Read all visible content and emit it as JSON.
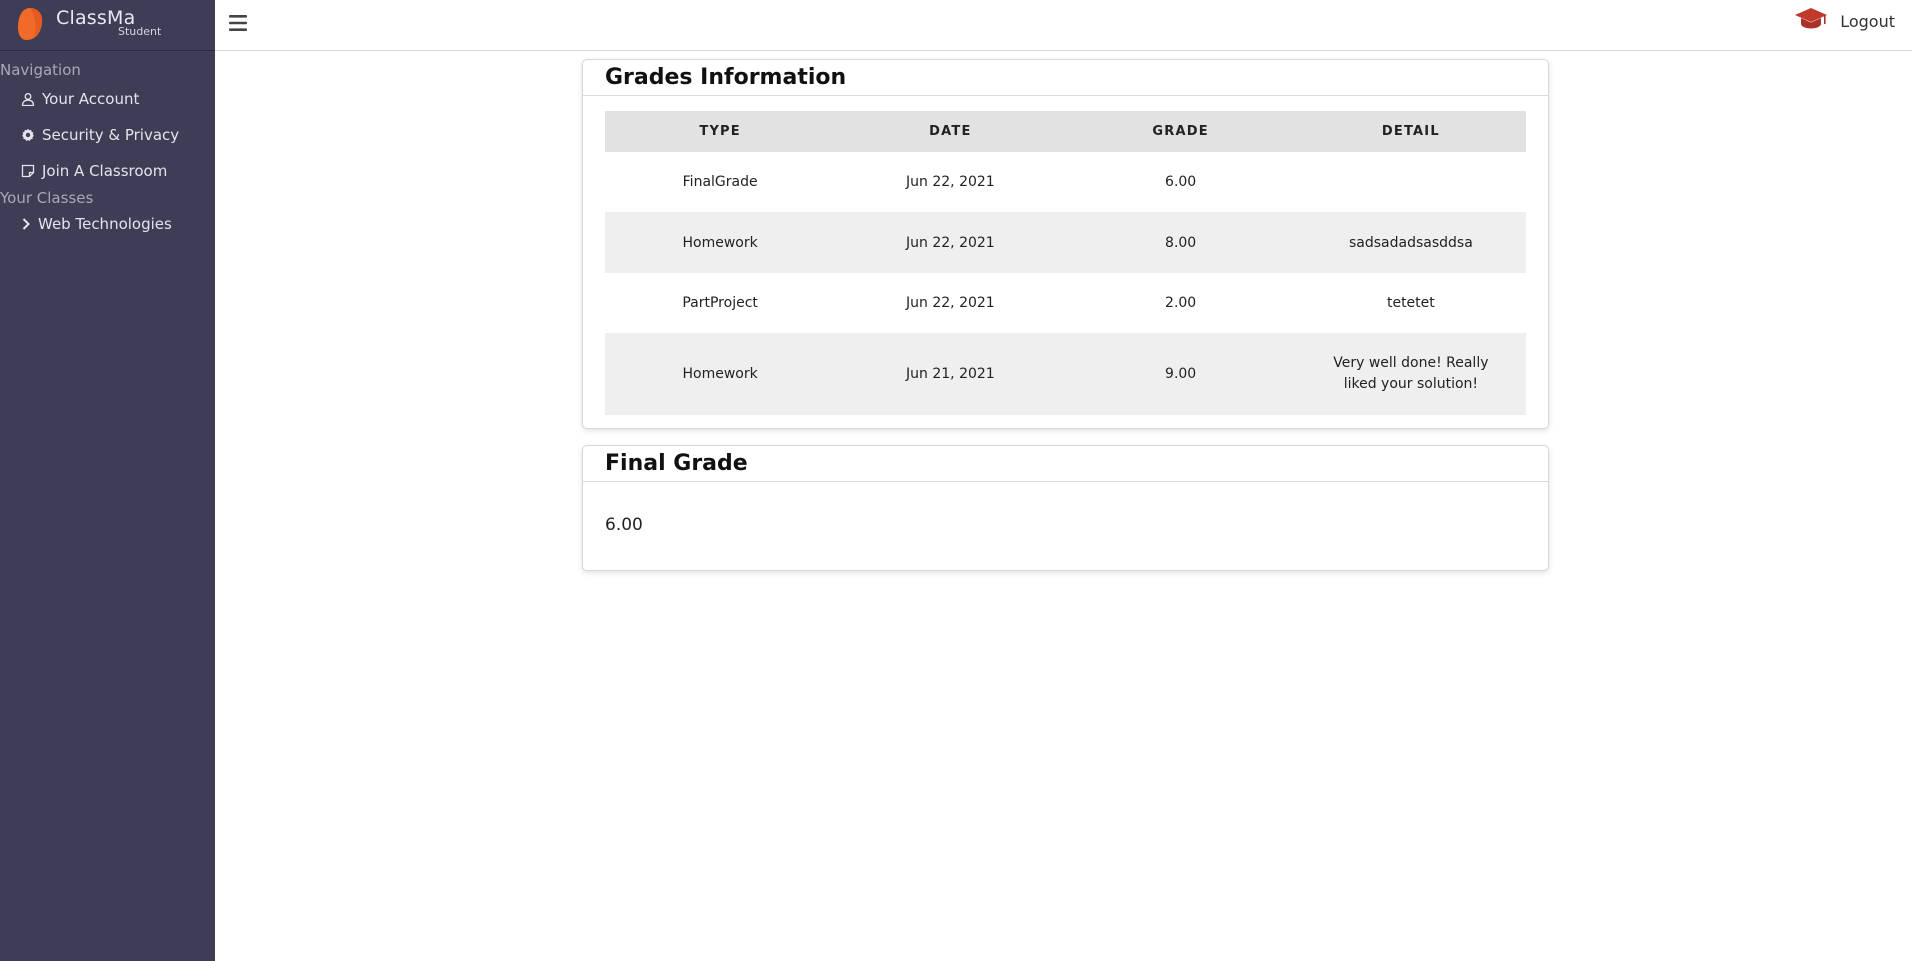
{
  "brand": {
    "name": "ClassMa",
    "role": "Student",
    "logo_color": "#f26a2a"
  },
  "sidebar": {
    "sections": [
      {
        "title": "Navigation",
        "items": [
          {
            "label": "Your Account",
            "icon": "user-icon"
          },
          {
            "label": "Security & Privacy",
            "icon": "gear-icon"
          },
          {
            "label": "Join A Classroom",
            "icon": "note-icon"
          }
        ]
      },
      {
        "title": "Your Classes",
        "items": [
          {
            "label": "Web Technologies",
            "icon": "chevron-right-icon"
          }
        ]
      }
    ],
    "background": "#3f3d56"
  },
  "topbar": {
    "menu_icon": "hamburger-icon",
    "cap_icon": "graduation-cap-icon",
    "cap_color": "#c0392b",
    "logout_label": "Logout"
  },
  "grades_card": {
    "title": "Grades Information",
    "columns": [
      "TYPE",
      "DATE",
      "GRADE",
      "DETAIL"
    ],
    "rows": [
      {
        "type": "FinalGrade",
        "date": "Jun 22, 2021",
        "grade": "6.00",
        "detail": ""
      },
      {
        "type": "Homework",
        "date": "Jun 22, 2021",
        "grade": "8.00",
        "detail": "sadsadadsasddsa"
      },
      {
        "type": "PartProject",
        "date": "Jun 22, 2021",
        "grade": "2.00",
        "detail": "tetetet"
      },
      {
        "type": "Homework",
        "date": "Jun 21, 2021",
        "grade": "9.00",
        "detail": "Very well done! Really liked your solution!"
      }
    ]
  },
  "final_card": {
    "title": "Final Grade",
    "value": "6.00"
  }
}
